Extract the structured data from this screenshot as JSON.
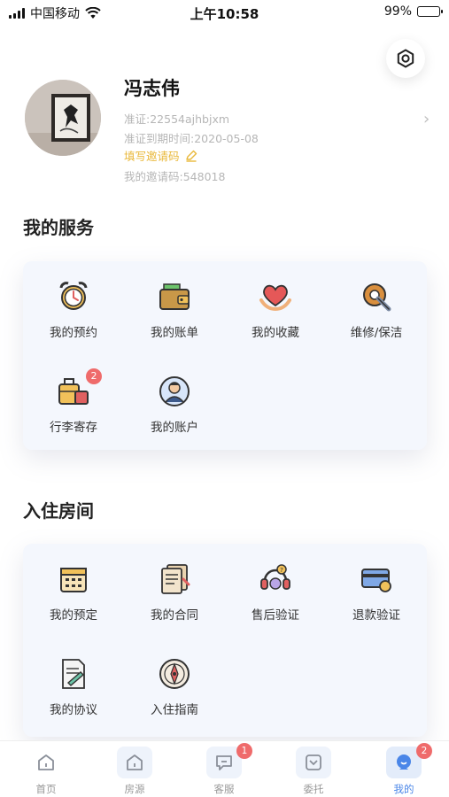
{
  "status_bar": {
    "carrier": "中国移动",
    "time": "上午10:58",
    "battery": "99%",
    "battery_level": 0.99
  },
  "settings": {
    "icon": "settings-hexagon-icon"
  },
  "profile": {
    "name": "冯志伟",
    "license": "准证:22554ajhbjxm",
    "expiry": "准证到期时间:2020-05-08",
    "fill_invite": "填写邀请码",
    "my_invite": "我的邀请码:548018"
  },
  "services": {
    "title": "我的服务",
    "items": [
      {
        "label": "我的预约",
        "icon": "alarm-clock-icon"
      },
      {
        "label": "我的账单",
        "icon": "wallet-icon"
      },
      {
        "label": "我的收藏",
        "icon": "heart-hands-icon"
      },
      {
        "label": "维修/保洁",
        "icon": "wrench-gear-icon"
      },
      {
        "label": "行李寄存",
        "icon": "luggage-icon",
        "badge": "2"
      },
      {
        "label": "我的账户",
        "icon": "user-account-icon"
      }
    ]
  },
  "rooms": {
    "title": "入住房间",
    "items": [
      {
        "label": "我的预定",
        "icon": "calendar-icon"
      },
      {
        "label": "我的合同",
        "icon": "contract-icon"
      },
      {
        "label": "售后验证",
        "icon": "headset-icon"
      },
      {
        "label": "退款验证",
        "icon": "card-refund-icon"
      },
      {
        "label": "我的协议",
        "icon": "agreement-icon"
      },
      {
        "label": "入住指南",
        "icon": "compass-icon"
      }
    ]
  },
  "tabbar": {
    "tabs": [
      {
        "label": "首页",
        "icon": "home-icon"
      },
      {
        "label": "房源",
        "icon": "house-icon"
      },
      {
        "label": "客服",
        "icon": "chat-icon",
        "badge": "1"
      },
      {
        "label": "委托",
        "icon": "down-box-icon"
      },
      {
        "label": "我的",
        "icon": "user-icon",
        "badge": "2",
        "active": true
      }
    ]
  },
  "colors": {
    "accent": "#4a86e8",
    "badge": "#ef6b6b",
    "invite": "#e9b83a",
    "card_bg": "#f4f7fd"
  }
}
